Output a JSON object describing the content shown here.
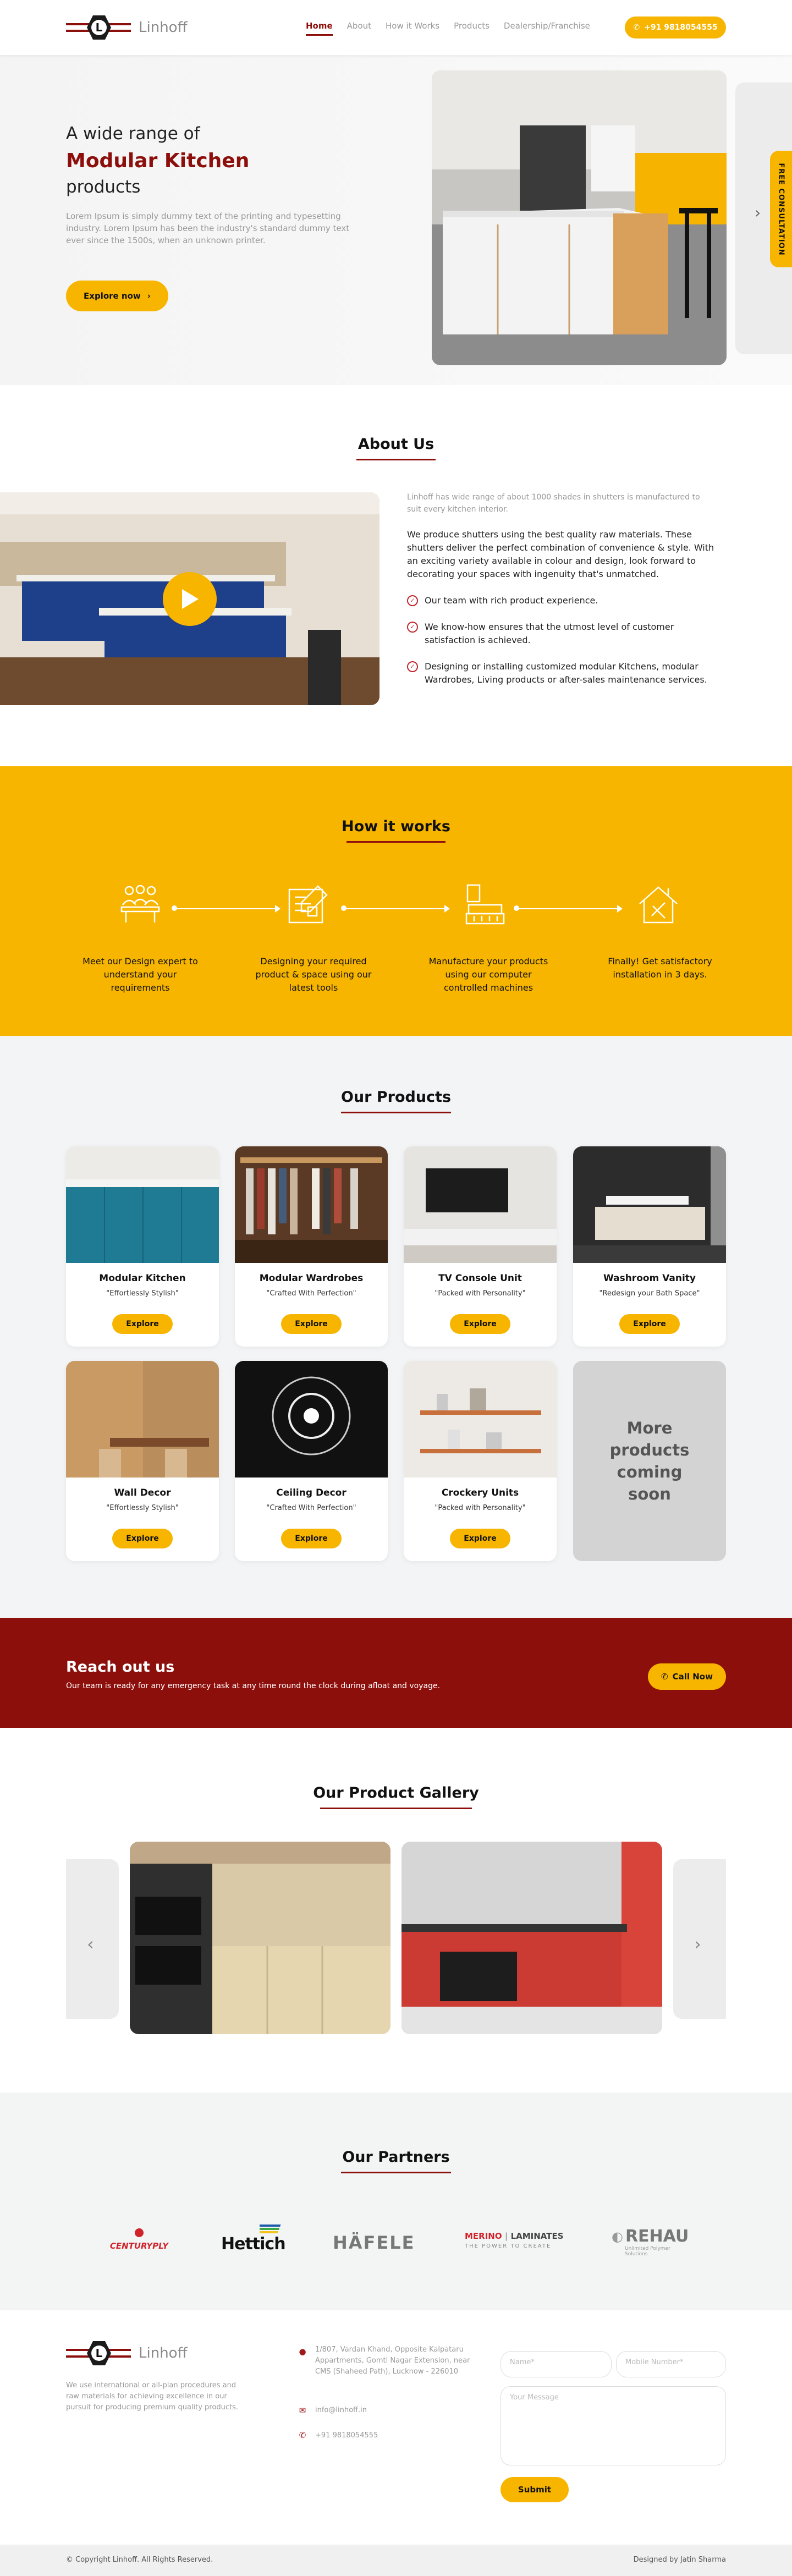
{
  "brand": {
    "name": "Linhoff",
    "logo_letter": "L"
  },
  "nav": {
    "items": [
      {
        "label": "Home",
        "active": true
      },
      {
        "label": "About",
        "active": false
      },
      {
        "label": "How it Works",
        "active": false
      },
      {
        "label": "Products",
        "active": false
      },
      {
        "label": "Dealership/Franchise",
        "active": false
      }
    ],
    "phone": "+91 9818054555"
  },
  "hero": {
    "line1": "A wide range of",
    "line2": "Modular Kitchen",
    "line3": "products",
    "paragraph": "Lorem Ipsum is simply dummy text of the printing and typesetting industry. Lorem Ipsum has been the industry's standard dummy text ever since the 1500s, when an unknown printer.",
    "cta": "Explore now",
    "side_tab": "FREE CONSULTATION"
  },
  "about": {
    "title": "About Us",
    "intro": "Linhoff has wide range of about 1000 shades in shutters is manufactured to suit every kitchen interior.",
    "paragraph": "We produce shutters using the best quality raw materials. These shutters deliver the perfect combination of convenience & style. With an exciting variety available in colour and design, look forward to decorating your spaces with ingenuity that's unmatched.",
    "points": [
      "Our team with rich product experience.",
      "We know-how ensures that the utmost level of customer satisfaction is achieved.",
      "Designing or installing customized modular Kitchens, modular Wardrobes, Living products or after-sales maintenance services."
    ]
  },
  "how": {
    "title": "How it works",
    "steps": [
      "Meet our Design expert to understand your requirements",
      "Designing your required product & space using our latest tools",
      "Manufacture your products using our computer controlled machines",
      "Finally! Get satisfactory installation in 3 days."
    ]
  },
  "products": {
    "title": "Our Products",
    "button_label": "Explore",
    "items": [
      {
        "title": "Modular Kitchen",
        "tagline": "\"Effortlessly Stylish\""
      },
      {
        "title": "Modular Wardrobes",
        "tagline": "\"Crafted With Perfection\""
      },
      {
        "title": "TV Console Unit",
        "tagline": "\"Packed with Personality\""
      },
      {
        "title": "Washroom Vanity",
        "tagline": "\"Redesign your Bath Space\""
      },
      {
        "title": "Wall Decor",
        "tagline": "\"Effortlessly Stylish\""
      },
      {
        "title": "Ceiling Decor",
        "tagline": "\"Crafted With Perfection\""
      },
      {
        "title": "Crockery Units",
        "tagline": "\"Packed with Personality\""
      }
    ],
    "more": "More products coming soon"
  },
  "reach": {
    "title": "Reach out us",
    "subtitle": "Our team is ready for any emergency task at any time round the clock during afloat and voyage.",
    "button": "Call Now"
  },
  "gallery": {
    "title": "Our Product Gallery"
  },
  "partners": {
    "title": "Our Partners",
    "logos": [
      "CENTURYPLY",
      "Hettich",
      "HÄFELE",
      "MERINO",
      "LAMINATES",
      "THE POWER TO CREATE",
      "REHAU",
      "Unlimited Polymer Solutions"
    ]
  },
  "footer": {
    "about": "We use international or all-plan procedures and raw materials for achieving excellence in our pursuit for producing premium quality products.",
    "address": "1/807, Vardan Khand, Opposite Kalpataru Appartments, Gomti Nagar Extension, near CMS (Shaheed Path), Lucknow - 226010",
    "email": "info@linhoff.in",
    "phone": "+91 9818054555",
    "form": {
      "name_placeholder": "Name*",
      "mobile_placeholder": "Mobile Number*",
      "message_placeholder": "Your Message",
      "submit": "Submit"
    },
    "copyright": "© Copyright Linhoff. All Rights Reserved.",
    "credit": "Designed by Jatin Sharma"
  },
  "colors": {
    "primary": "#8d0f0c",
    "accent": "#f7b500"
  }
}
